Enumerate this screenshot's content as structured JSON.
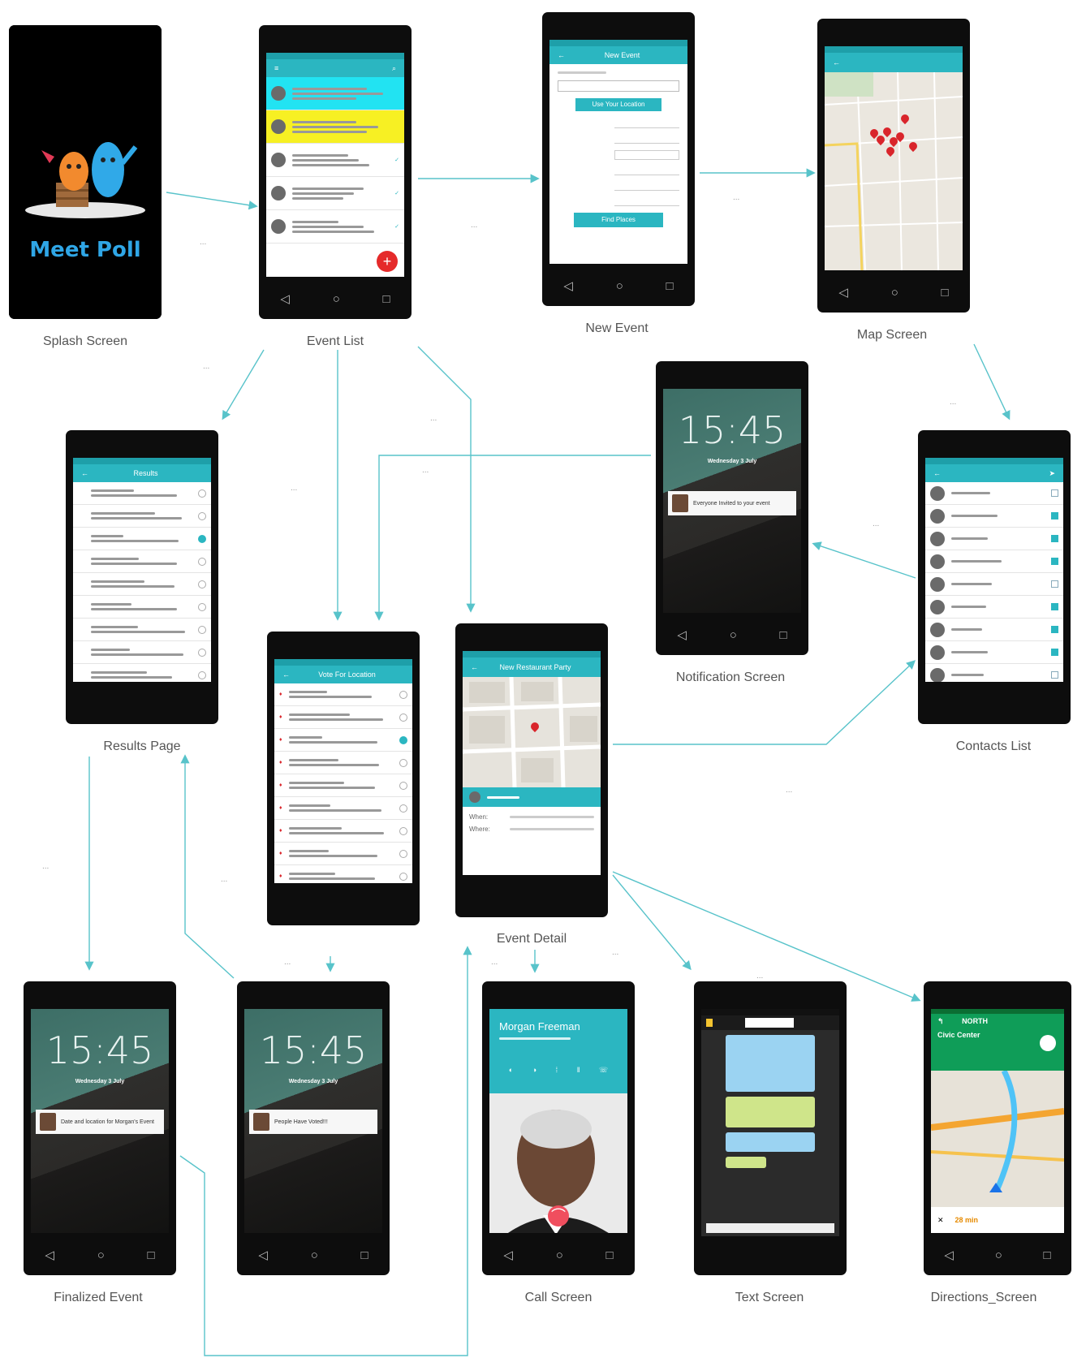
{
  "screens": {
    "splash": {
      "caption": "Splash Screen",
      "logo_text": "Meet Poll"
    },
    "event_list": {
      "caption": "Event List"
    },
    "new_event": {
      "caption": "New Event",
      "title": "New Event",
      "location_button": "Use Your Location",
      "find_button": "Find Places"
    },
    "map": {
      "caption": "Map Screen"
    },
    "results": {
      "caption": "Results Page",
      "title": "Results"
    },
    "vote": {
      "title": "Vote For Location"
    },
    "event_detail": {
      "caption": "Event Detail",
      "title": "New Restaurant Party",
      "when_label": "When:",
      "where_label": "Where:"
    },
    "notification": {
      "caption": "Notification Screen",
      "time": "15:45",
      "date": "Wednesday 3 July",
      "message": "Everyone Invited to your event"
    },
    "contacts": {
      "caption": "Contacts List"
    },
    "finalized": {
      "caption": "Finalized Event",
      "time": "15:45",
      "date": "Wednesday 3 July",
      "message": "Date and location for Morgan's Event"
    },
    "people_voted": {
      "time": "15:45",
      "date": "Wednesday 3 July",
      "message": "People Have Voted!!!"
    },
    "call": {
      "caption": "Call Screen",
      "name": "Morgan Freeman"
    },
    "text": {
      "caption": "Text Screen"
    },
    "directions": {
      "caption": "Directions_Screen",
      "road": "NORTH",
      "dest": "Civic Center",
      "eta": "28 min"
    }
  },
  "connector_dots": "..."
}
